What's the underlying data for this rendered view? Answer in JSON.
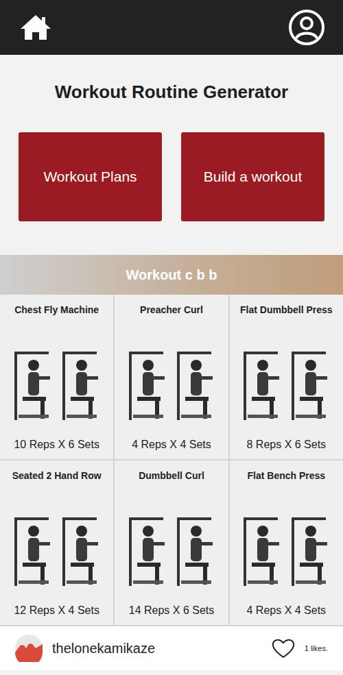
{
  "app": {
    "title": "Workout Routine Generator"
  },
  "actions": [
    {
      "label": "Workout Plans"
    },
    {
      "label": "Build a workout"
    }
  ],
  "workout": {
    "title": "Workout c b b",
    "exercises": [
      {
        "name": "Chest Fly Machine",
        "reps": "10 Reps X 6 Sets"
      },
      {
        "name": "Preacher Curl",
        "reps": "4 Reps X 4 Sets"
      },
      {
        "name": "Flat Dumbbell Press",
        "reps": "8 Reps X 6 Sets"
      },
      {
        "name": "Seated 2 Hand Row",
        "reps": "12 Reps X 4 Sets"
      },
      {
        "name": "Dumbbell Curl",
        "reps": "14 Reps X 6 Sets"
      },
      {
        "name": "Flat Bench Press",
        "reps": "4 Reps X 4 Sets"
      }
    ]
  },
  "post": {
    "user": "thelonekamikaze",
    "likes": "1 likes.",
    "liked": false
  }
}
